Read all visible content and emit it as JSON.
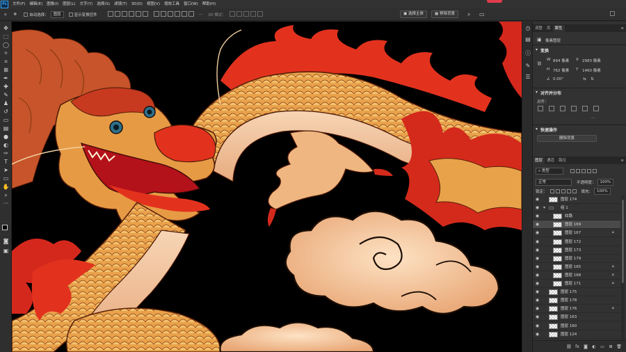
{
  "app": {
    "logo": "Ps"
  },
  "menu": [
    "文件(F)",
    "编辑(E)",
    "图像(I)",
    "图层(L)",
    "文字(Y)",
    "选择(S)",
    "滤镜(T)",
    "3D(D)",
    "视图(V)",
    "增效工具",
    "窗口(W)",
    "帮助(H)"
  ],
  "options": {
    "auto_select_label": "自动选择：",
    "auto_select_value": "图层",
    "show_transform_label": "显示变换控件",
    "mode_label": "3D 模式：",
    "select_subject": "选择主体",
    "remove_background": "移除背景"
  },
  "panels": {
    "top_tabs": [
      "调整",
      "库",
      "属性"
    ],
    "active_top_tab": "属性",
    "pixel_layer_label": "像素图层",
    "transform": {
      "heading": "变换",
      "w_label": "W",
      "w_value": "894 像素",
      "x_label": "X",
      "x_value": "2983 像素",
      "h_label": "H",
      "h_value": "762 像素",
      "y_label": "Y",
      "y_value": "1460 像素",
      "angle_value": "0.00°"
    },
    "align": {
      "heading": "对齐并分布",
      "sub": "对齐："
    },
    "quick_actions": {
      "heading": "快速操作",
      "button": "删除背景"
    },
    "layer_tabs": [
      "图层",
      "通道",
      "路径"
    ],
    "active_layer_tab": "图层",
    "filter_kind": "类型",
    "blend_mode": "正常",
    "opacity_label": "不透明度：",
    "opacity_value": "100%",
    "lock_label": "锁定：",
    "fill_label": "填充：",
    "fill_value": "100%",
    "layers": [
      {
        "name": "图层 174",
        "locked": false,
        "selected": false,
        "indent": 0,
        "kind": "layer"
      },
      {
        "name": "组 1",
        "locked": false,
        "selected": false,
        "indent": 0,
        "kind": "group"
      },
      {
        "name": "纹路",
        "locked": false,
        "selected": false,
        "indent": 1,
        "kind": "layer"
      },
      {
        "name": "图层 169",
        "locked": false,
        "selected": true,
        "indent": 1,
        "kind": "layer"
      },
      {
        "name": "图层 167",
        "locked": true,
        "selected": false,
        "indent": 1,
        "kind": "layer"
      },
      {
        "name": "图层 172",
        "locked": false,
        "selected": false,
        "indent": 1,
        "kind": "layer"
      },
      {
        "name": "图层 173",
        "locked": false,
        "selected": false,
        "indent": 1,
        "kind": "layer"
      },
      {
        "name": "图层 179",
        "locked": false,
        "selected": false,
        "indent": 1,
        "kind": "layer"
      },
      {
        "name": "图层 165",
        "locked": true,
        "selected": false,
        "indent": 1,
        "kind": "layer"
      },
      {
        "name": "图层 168",
        "locked": true,
        "selected": false,
        "indent": 1,
        "kind": "layer"
      },
      {
        "name": "图层 171",
        "locked": true,
        "selected": false,
        "indent": 1,
        "kind": "layer"
      },
      {
        "name": "图层 175",
        "locked": false,
        "selected": false,
        "indent": 0,
        "kind": "layer"
      },
      {
        "name": "图层 178",
        "locked": false,
        "selected": false,
        "indent": 0,
        "kind": "layer"
      },
      {
        "name": "图层 176",
        "locked": true,
        "selected": false,
        "indent": 0,
        "kind": "layer"
      },
      {
        "name": "图层 163",
        "locked": false,
        "selected": false,
        "indent": 0,
        "kind": "layer"
      },
      {
        "name": "图层 160",
        "locked": false,
        "selected": false,
        "indent": 0,
        "kind": "layer"
      },
      {
        "name": "图层 124",
        "locked": false,
        "selected": false,
        "indent": 0,
        "kind": "layer"
      }
    ],
    "footer_icons": [
      "link-icon",
      "fx-icon",
      "mask-icon",
      "adjustment-icon",
      "folder-icon",
      "new-layer-icon",
      "trash-icon"
    ]
  },
  "colors": {
    "canvas_bg": "#000000",
    "dragon_red": "#e0301e",
    "dragon_gold": "#e8a24a",
    "cloud": "#f3c79a"
  }
}
